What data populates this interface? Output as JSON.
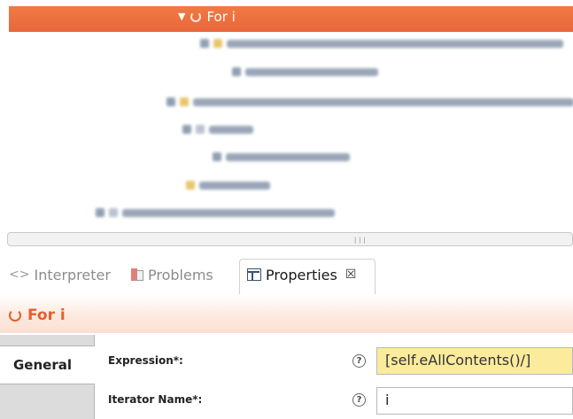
{
  "tree": {
    "selected": {
      "label": "For i"
    }
  },
  "tabs": [
    {
      "label": "Interpreter"
    },
    {
      "label": "Problems"
    },
    {
      "label": "Properties"
    }
  ],
  "close_glyph": "☒",
  "properties": {
    "title": "For i",
    "side_tab": "General",
    "fields": [
      {
        "label": "Expression*:",
        "help": "?",
        "value": "[self.eAllContents()/]"
      },
      {
        "label": "Iterator Name*:",
        "help": "?",
        "value": "i"
      }
    ]
  },
  "colors": {
    "selection": "#e8673a",
    "accent": "#e35f2c",
    "expression_bg": "#fbeb9c"
  }
}
